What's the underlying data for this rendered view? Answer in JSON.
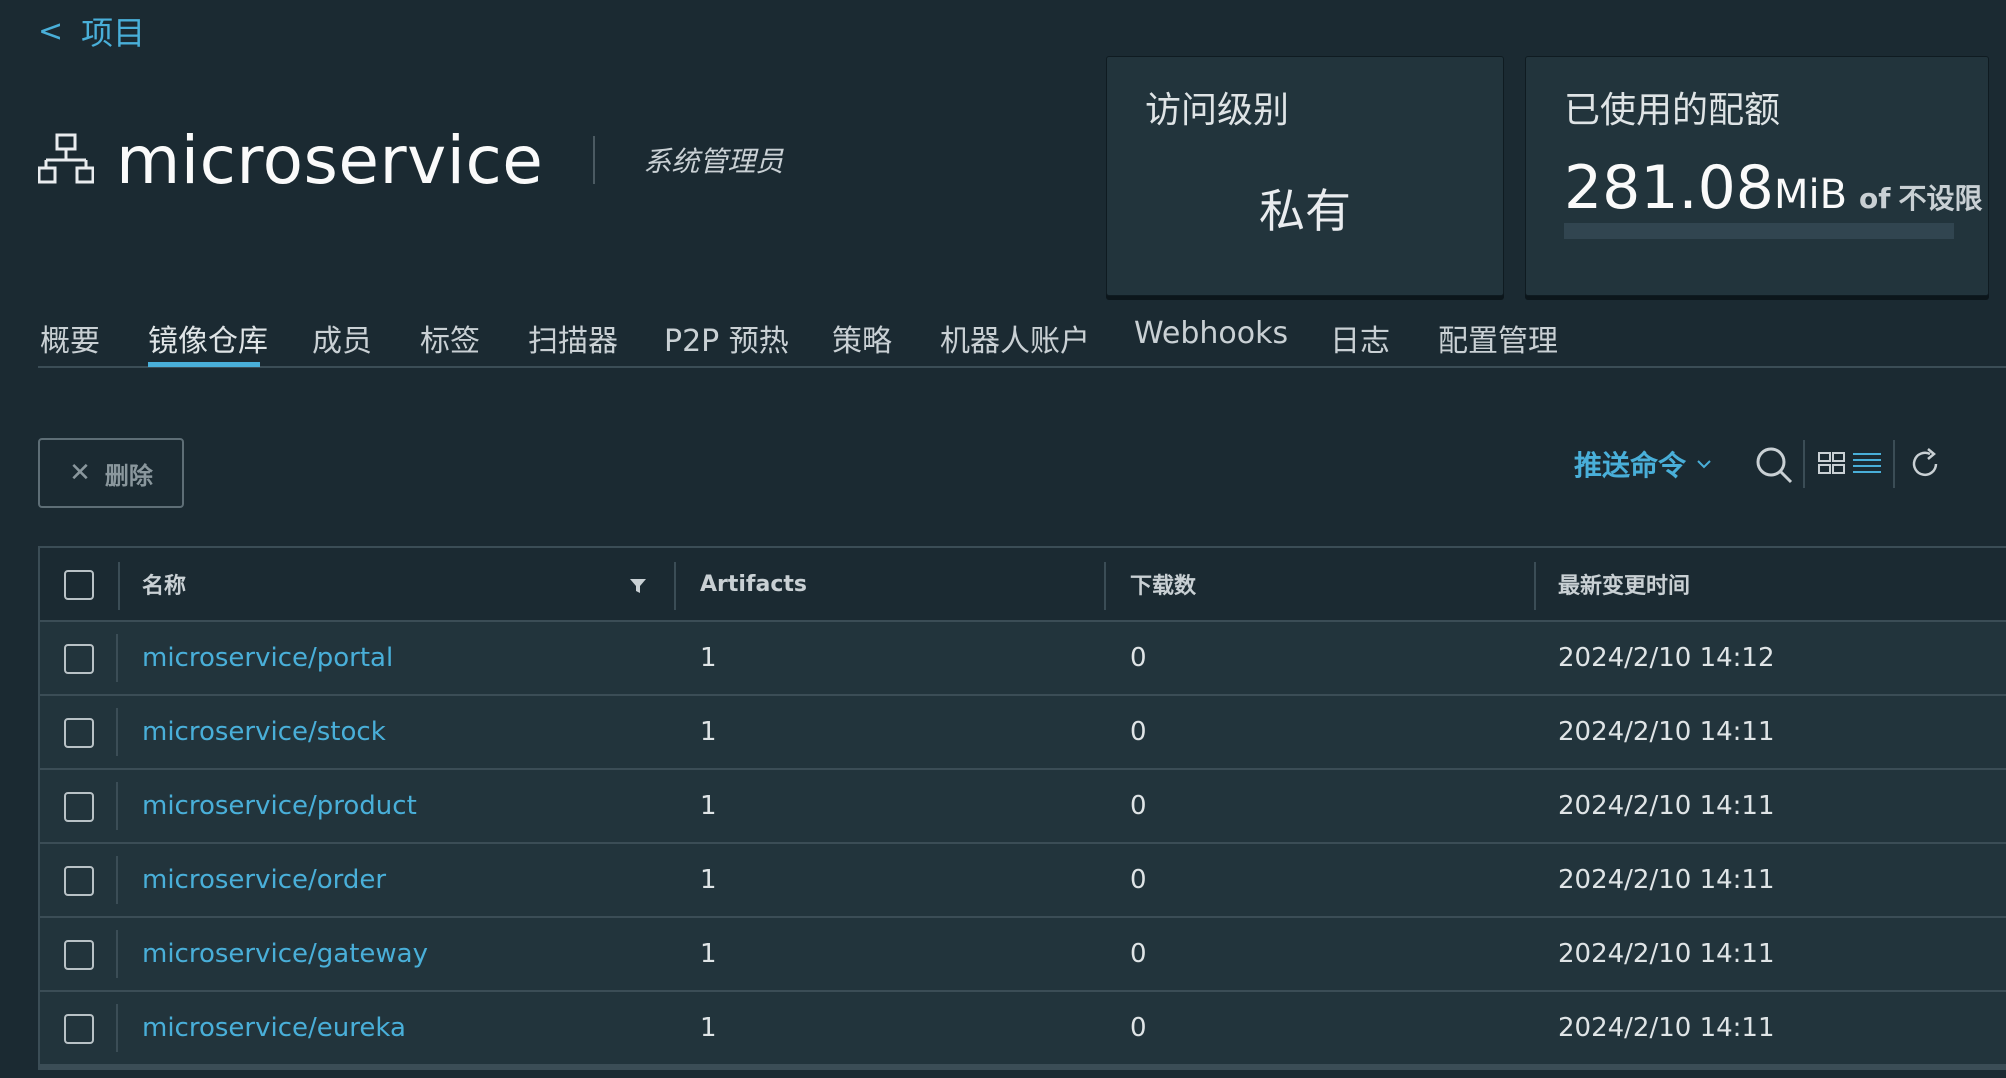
{
  "nav": {
    "back_label": "项目",
    "back_chevron": "<"
  },
  "project": {
    "icon": "project-tree-icon",
    "name": "microservice",
    "role": "系统管理员"
  },
  "cards": {
    "access": {
      "title": "访问级别",
      "value": "私有"
    },
    "quota": {
      "title": "已使用的配额",
      "value": "281.08",
      "unit": "MiB",
      "of": "of",
      "limit": "不设限",
      "used_fraction": 0
    }
  },
  "tabs": [
    {
      "label": "概要"
    },
    {
      "label": "镜像仓库",
      "active": true
    },
    {
      "label": "成员"
    },
    {
      "label": "标签"
    },
    {
      "label": "扫描器"
    },
    {
      "label": "P2P 预热"
    },
    {
      "label": "策略"
    },
    {
      "label": "机器人账户"
    },
    {
      "label": "Webhooks"
    },
    {
      "label": "日志"
    },
    {
      "label": "配置管理"
    }
  ],
  "toolbar": {
    "delete_label": "删除",
    "push_command_label": "推送命令",
    "icons": [
      "close-icon",
      "chevron-down-icon",
      "search-icon",
      "grid-view-icon",
      "list-view-icon",
      "refresh-icon"
    ]
  },
  "table": {
    "columns": [
      "名称",
      "Artifacts",
      "下载数",
      "最新变更时间"
    ],
    "rows": [
      {
        "name": "microservice/portal",
        "artifacts": "1",
        "pulls": "0",
        "updated": "2024/2/10 14:12"
      },
      {
        "name": "microservice/stock",
        "artifacts": "1",
        "pulls": "0",
        "updated": "2024/2/10 14:11"
      },
      {
        "name": "microservice/product",
        "artifacts": "1",
        "pulls": "0",
        "updated": "2024/2/10 14:11"
      },
      {
        "name": "microservice/order",
        "artifacts": "1",
        "pulls": "0",
        "updated": "2024/2/10 14:11"
      },
      {
        "name": "microservice/gateway",
        "artifacts": "1",
        "pulls": "0",
        "updated": "2024/2/10 14:11"
      },
      {
        "name": "microservice/eureka",
        "artifacts": "1",
        "pulls": "0",
        "updated": "2024/2/10 14:11"
      }
    ]
  },
  "colors": {
    "accent": "#49afd9",
    "background": "#1b2a32",
    "card": "#22343c",
    "border": "#3b4d56"
  }
}
